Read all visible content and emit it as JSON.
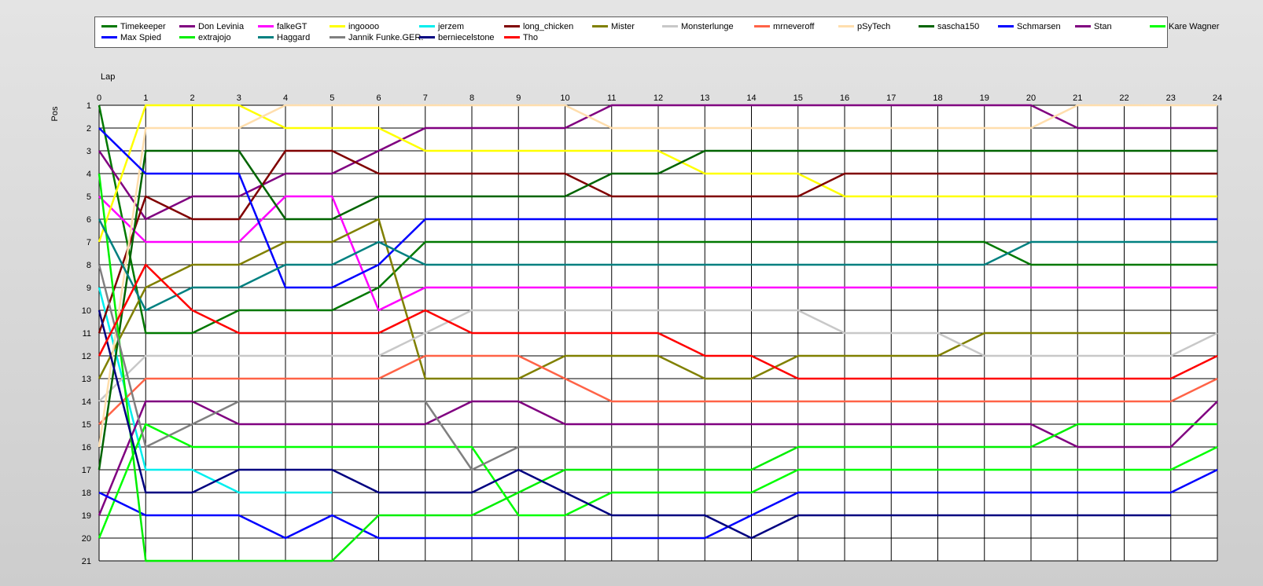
{
  "chart_data": {
    "type": "line",
    "title": "",
    "xlabel": "Lap",
    "ylabel": "Pos",
    "x": [
      0,
      1,
      2,
      3,
      4,
      5,
      6,
      7,
      8,
      9,
      10,
      11,
      12,
      13,
      14,
      15,
      16,
      17,
      18,
      19,
      20,
      21,
      22,
      23,
      24
    ],
    "xlim": [
      0,
      24
    ],
    "ylim": [
      1,
      21
    ],
    "y_ticks": [
      1,
      2,
      3,
      4,
      5,
      6,
      7,
      8,
      9,
      10,
      11,
      12,
      13,
      14,
      15,
      16,
      17,
      18,
      19,
      20,
      21
    ],
    "y_inverted": true,
    "grid": true,
    "legend_position": "top",
    "series": [
      {
        "name": "Timekeeper",
        "color": "#007800",
        "values": [
          1,
          11,
          11,
          10,
          10,
          10,
          9,
          7,
          7,
          7,
          7,
          7,
          7,
          7,
          7,
          7,
          7,
          7,
          7,
          7,
          8,
          8,
          8,
          8,
          8
        ]
      },
      {
        "name": "Don Levinia",
        "color": "#800080",
        "values": [
          3,
          6,
          5,
          5,
          4,
          4,
          3,
          2,
          2,
          2,
          2,
          1,
          1,
          1,
          1,
          1,
          1,
          1,
          1,
          1,
          1,
          2,
          2,
          2,
          2
        ]
      },
      {
        "name": "falkeGT",
        "color": "#ff00ff",
        "values": [
          5,
          7,
          7,
          7,
          5,
          5,
          10,
          9,
          9,
          9,
          9,
          9,
          9,
          9,
          9,
          9,
          9,
          9,
          9,
          9,
          9,
          9,
          9,
          9,
          9
        ]
      },
      {
        "name": "ingoooo",
        "color": "#ffff00",
        "values": [
          7,
          1,
          1,
          1,
          2,
          2,
          2,
          3,
          3,
          3,
          3,
          3,
          3,
          4,
          4,
          4,
          5,
          5,
          5,
          5,
          5,
          5,
          5,
          5,
          5
        ]
      },
      {
        "name": "jerzem",
        "color": "#00eeee",
        "values": [
          9,
          17,
          17,
          18,
          18,
          18
        ]
      },
      {
        "name": "long_chicken",
        "color": "#800000",
        "values": [
          11,
          5,
          6,
          6,
          3,
          3,
          4,
          4,
          4,
          4,
          4,
          5,
          5,
          5,
          5,
          5,
          4,
          4,
          4,
          4,
          4,
          4,
          4,
          4,
          4
        ]
      },
      {
        "name": "Mister",
        "color": "#808000",
        "values": [
          13,
          9,
          8,
          8,
          7,
          7,
          6,
          13,
          13,
          13,
          12,
          12,
          12,
          13,
          13,
          12,
          12,
          12,
          12,
          11,
          11,
          11,
          11,
          11
        ]
      },
      {
        "name": "Monsterlunge",
        "color": "#c8c8c8",
        "values": [
          14,
          12,
          12,
          12,
          12,
          12,
          12,
          11,
          10,
          10,
          10,
          10,
          10,
          10,
          10,
          10,
          11,
          11,
          11,
          12,
          12,
          12,
          12,
          12,
          11
        ]
      },
      {
        "name": "mrneveroff",
        "color": "#ff6347",
        "values": [
          15,
          13,
          13,
          13,
          13,
          13,
          13,
          12,
          12,
          12,
          13,
          14,
          14,
          14,
          14,
          14,
          14,
          14,
          14,
          14,
          14,
          14,
          14,
          14,
          13
        ]
      },
      {
        "name": "pSyTech",
        "color": "#ffdead",
        "values": [
          16,
          2,
          2,
          2,
          1,
          1,
          1,
          1,
          1,
          1,
          1,
          2,
          2,
          2,
          2,
          2,
          2,
          2,
          2,
          2,
          2,
          1,
          1,
          1,
          1
        ]
      },
      {
        "name": "sascha150",
        "color": "#006400",
        "values": [
          17,
          3,
          3,
          3,
          6,
          6,
          5,
          5,
          5,
          5,
          5,
          4,
          4,
          3,
          3,
          3,
          3,
          3,
          3,
          3,
          3,
          3,
          3,
          3,
          3
        ]
      },
      {
        "name": "Schmarsen",
        "color": "#0000ff",
        "values": [
          2,
          4,
          4,
          4,
          9,
          9,
          8,
          6,
          6,
          6,
          6,
          6,
          6,
          6,
          6,
          6,
          6,
          6,
          6,
          6,
          6,
          6,
          6,
          6,
          6
        ]
      },
      {
        "name": "Stan",
        "color": "#800080",
        "values": [
          19,
          14,
          14,
          15,
          15,
          15,
          15,
          15,
          14,
          14,
          15,
          15,
          15,
          15,
          15,
          15,
          15,
          15,
          15,
          15,
          15,
          16,
          16,
          16,
          14
        ]
      },
      {
        "name": "Kare Wagner",
        "color": "#00ff00",
        "values": [
          20,
          15,
          16,
          16,
          16,
          16,
          16,
          16,
          16,
          19,
          19,
          18,
          18,
          18,
          18,
          17,
          17,
          17,
          17,
          17,
          17,
          17,
          17,
          17,
          16
        ]
      },
      {
        "name": "Max Spied",
        "color": "#0000ff",
        "values": [
          18,
          19,
          19,
          19,
          20,
          19,
          20,
          20,
          20,
          20,
          20,
          20,
          20,
          20,
          19,
          18,
          18,
          18,
          18,
          18,
          18,
          18,
          18,
          18,
          17
        ]
      },
      {
        "name": "extrajojo",
        "color": "#00ee00",
        "values": [
          4,
          21,
          21,
          21,
          21,
          21,
          19,
          19,
          19,
          18,
          17,
          17,
          17,
          17,
          17,
          16,
          16,
          16,
          16,
          16,
          16,
          15,
          15,
          15,
          15
        ]
      },
      {
        "name": "Haggard",
        "color": "#008080",
        "values": [
          6,
          10,
          9,
          9,
          8,
          8,
          7,
          8,
          8,
          8,
          8,
          8,
          8,
          8,
          8,
          8,
          8,
          8,
          8,
          8,
          7,
          7,
          7,
          7,
          7
        ]
      },
      {
        "name": "Jannik Funke.GER.",
        "color": "#808080",
        "values": [
          8,
          16,
          15,
          14,
          14,
          14,
          14,
          14,
          17,
          16,
          16,
          16,
          16,
          16,
          16
        ]
      },
      {
        "name": "berniecelstone",
        "color": "#000080",
        "values": [
          10,
          18,
          18,
          17,
          17,
          17,
          18,
          18,
          18,
          17,
          18,
          19,
          19,
          19,
          20,
          19,
          19,
          19,
          19,
          19,
          19,
          19,
          19,
          19
        ]
      },
      {
        "name": "Tho",
        "color": "#ff0000",
        "values": [
          12,
          8,
          10,
          11,
          11,
          11,
          11,
          10,
          11,
          11,
          11,
          11,
          11,
          12,
          12,
          13,
          13,
          13,
          13,
          13,
          13,
          13,
          13,
          13,
          12
        ]
      }
    ]
  }
}
